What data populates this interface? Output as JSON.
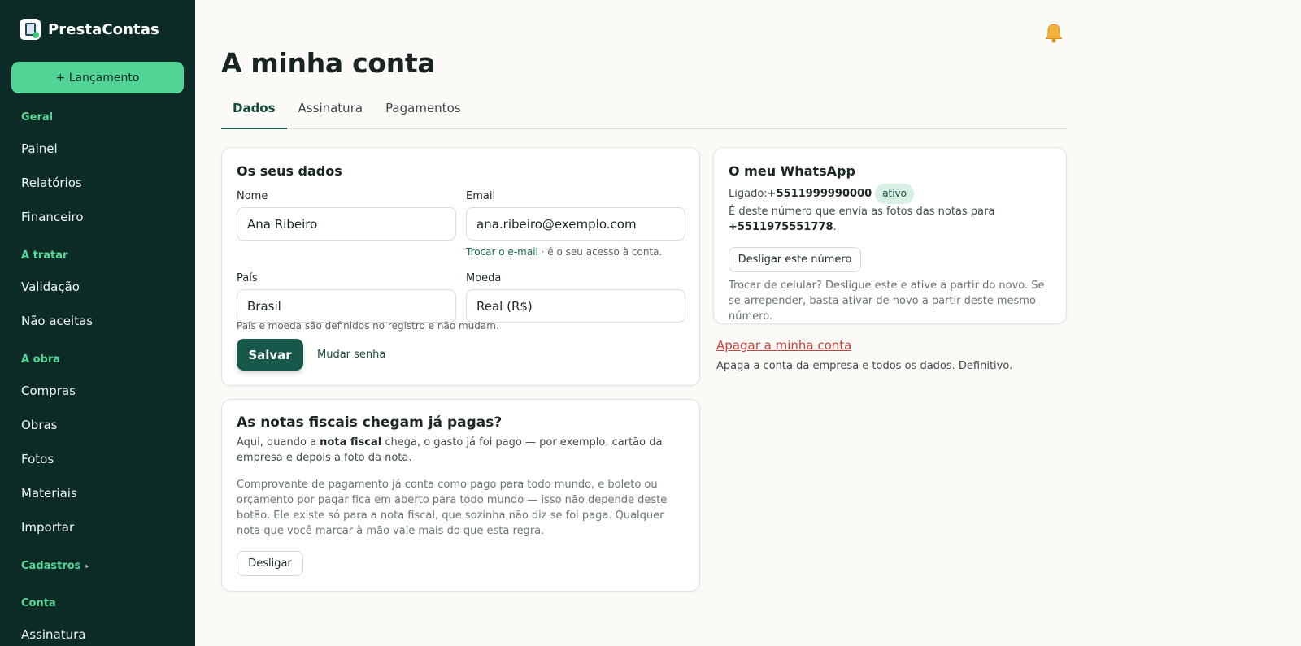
{
  "sidebar": {
    "brand": "PrestaContas",
    "new_button": "+ Lançamento",
    "sections": [
      {
        "label": "Geral",
        "items": [
          "Painel",
          "Relatórios",
          "Financeiro"
        ]
      },
      {
        "label": "A tratar",
        "items": [
          "Validação",
          "Não aceitas"
        ]
      },
      {
        "label": "A obra",
        "items": [
          "Compras",
          "Obras",
          "Fotos",
          "Materiais",
          "Importar"
        ]
      },
      {
        "label": "Cadastros",
        "items": []
      },
      {
        "label": "Conta",
        "items": [
          "Assinatura"
        ]
      }
    ]
  },
  "header": {
    "title": "A minha conta",
    "tabs": [
      "Dados",
      "Assinatura",
      "Pagamentos"
    ]
  },
  "data_card": {
    "title": "Os seus dados",
    "name_label": "Nome",
    "name_value": "Ana Ribeiro",
    "email_label": "Email",
    "email_value": "ana.ribeiro@exemplo.com",
    "email_change": "Trocar o e-mail",
    "email_hint": " · é o seu acesso à conta.",
    "country_label": "País",
    "country_value": "Brasil",
    "currency_label": "Moeda",
    "currency_value": "Real (R$)",
    "fixed_hint": "País e moeda são definidos no registro e não mudam.",
    "save_button": "Salvar",
    "change_password": "Mudar senha"
  },
  "invoice_card": {
    "title": "As notas fiscais chegam já pagas?",
    "p1_a": "Aqui, quando a ",
    "p1_b": "nota fiscal",
    "p1_c": " chega, o gasto já foi pago — por exemplo, cartão da empresa e depois a foto da nota.",
    "p2": "Comprovante de pagamento já conta como pago para todo mundo, e boleto ou orçamento por pagar fica em aberto para todo mundo — isso não depende deste botão. Ele existe só para a nota fiscal, que sozinha não diz se foi paga. Qualquer nota que você marcar à mão vale mais do que esta regra.",
    "button": "Desligar"
  },
  "whatsapp_card": {
    "title": "O meu WhatsApp",
    "linked_label": "Ligado: ",
    "linked_number": "+5511999990000",
    "status_badge": "ativo",
    "send_text": "É deste número que envia as fotos das notas para",
    "target_number": "+5511975551778",
    "period": ".",
    "disconnect_button": "Desligar este número",
    "change_text": "Trocar de celular? Desligue este e ative a partir do novo. Se se arrepender, basta ativar de novo a partir deste mesmo número."
  },
  "danger": {
    "delete_link": "Apagar a minha conta",
    "delete_hint": "Apaga a conta da empresa e todos os dados. Definitivo."
  },
  "colors": {
    "sidebar_bg": "#0d2b26",
    "accent": "#52d497",
    "primary": "#16594a",
    "danger": "#c9413a"
  }
}
